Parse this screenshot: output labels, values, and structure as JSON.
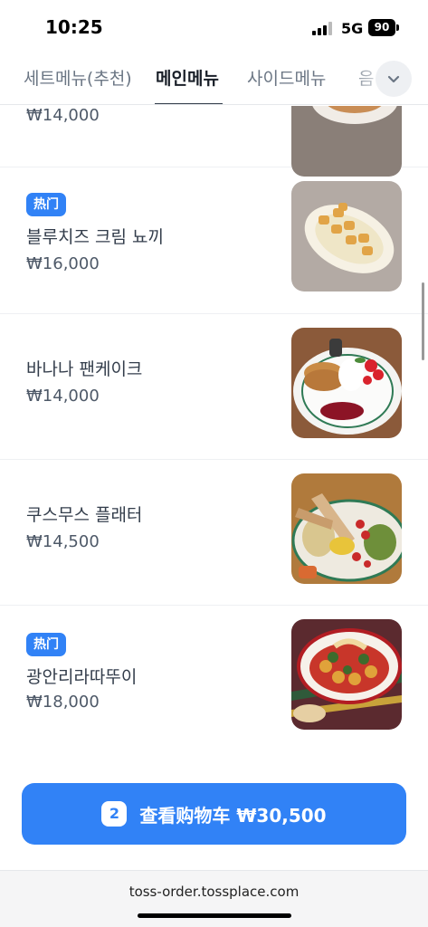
{
  "status_bar": {
    "time": "10:25",
    "network": "5G",
    "battery": "90"
  },
  "tabs": [
    {
      "label": "세트메뉴(추천)",
      "active": false
    },
    {
      "label": "메인메뉴",
      "active": true
    },
    {
      "label": "사이드메뉴",
      "active": false
    },
    {
      "label": "음",
      "active": false
    }
  ],
  "tab_expand_icon": "chevron-down-icon",
  "menu": {
    "items": [
      {
        "name": "",
        "price": "₩14,000",
        "badge": "",
        "image": "dish-plate"
      },
      {
        "name": "블루치즈 크림 뇨끼",
        "price": "₩16,000",
        "badge": "热门",
        "image": "gnocchi"
      },
      {
        "name": "바나나 팬케이크",
        "price": "₩14,000",
        "badge": "",
        "image": "pancake"
      },
      {
        "name": "쿠스무스 플래터",
        "price": "₩14,500",
        "badge": "",
        "image": "platter"
      },
      {
        "name": "광안리라따뚜이",
        "price": "₩18,000",
        "badge": "热门",
        "image": "ratatouille"
      }
    ]
  },
  "cart": {
    "count": "2",
    "label": "查看购物车 ₩30,500"
  },
  "browser": {
    "url": "toss-order.tossplace.com"
  },
  "colors": {
    "accent": "#3182f6",
    "text": "#191f28",
    "subtext": "#4e5968"
  }
}
